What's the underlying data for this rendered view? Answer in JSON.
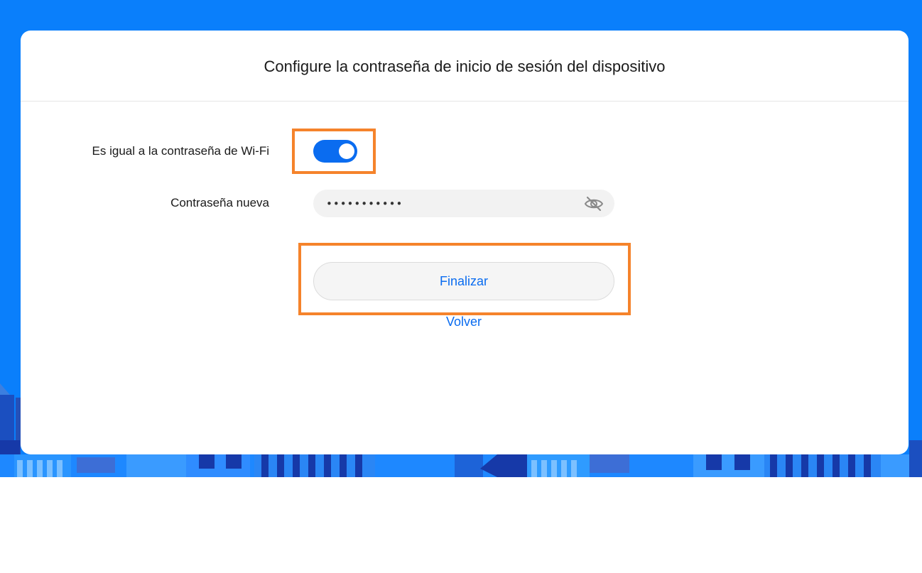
{
  "colors": {
    "background": "#0a7ffb",
    "accent": "#0a6cf0",
    "highlight": "#f5832b"
  },
  "card": {
    "title": "Configure la contraseña de inicio de sesión del dispositivo"
  },
  "form": {
    "same_as_wifi": {
      "label": "Es igual a la contraseña de Wi-Fi",
      "enabled": true
    },
    "new_password": {
      "label": "Contraseña nueva",
      "value": "•••••••••••",
      "visibility_icon": "eye-slash-icon"
    }
  },
  "actions": {
    "finish_label": "Finalizar",
    "back_label": "Volver"
  }
}
